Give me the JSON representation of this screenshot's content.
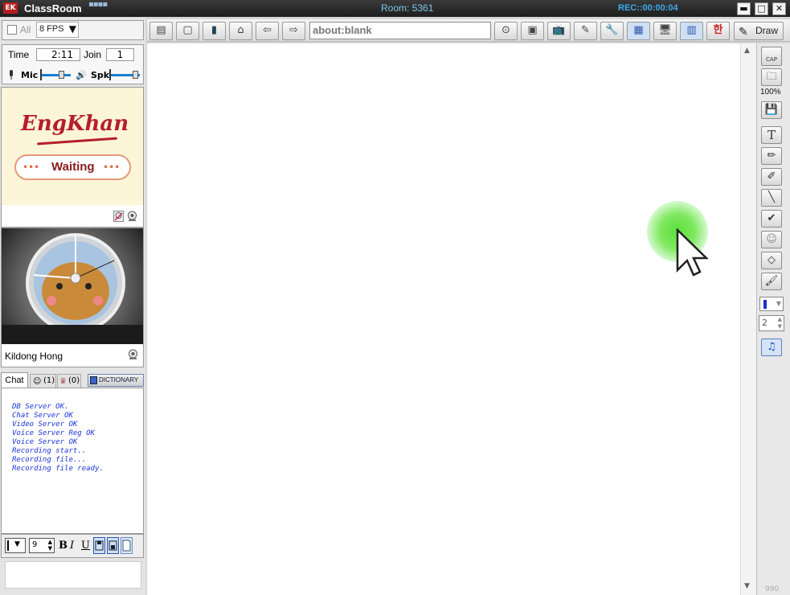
{
  "titlebar": {
    "app_logo": "EK",
    "app_title": "ClassRoom",
    "room": "Room: 5361",
    "rec": "REC::00:00:04",
    "minimize": "▬",
    "maximize": "□",
    "close": "✕"
  },
  "left_panel": {
    "all_label": "All",
    "fps_value": "8 FPS",
    "time_label": "Time",
    "time_value": "2:11",
    "join_label": "Join",
    "join_value": "1",
    "mic_label": "Mic",
    "spk_label": "Spk",
    "brand_logo": "EngKhan",
    "waiting_dots_left": "•••",
    "waiting_text": "Waiting",
    "waiting_dots_right": "•••",
    "student_name": "Kildong Hong"
  },
  "chat": {
    "tabs": [
      {
        "label": "Chat"
      },
      {
        "label": "(1)"
      },
      {
        "label": "(0)"
      }
    ],
    "dictionary_label": "DICTIONARY",
    "log": [
      "DB Server OK.",
      "Chat Server OK",
      "Video Server OK",
      "Voice Server Reg OK",
      "Voice Server OK",
      "Recording start..",
      "Recording file...",
      "Recording file ready."
    ],
    "font_size": "9",
    "bold_label": "B",
    "italic_label": "I",
    "underline_label": "U",
    "input_value": ""
  },
  "toolbar": {
    "url": "about:blank",
    "korean_label": "한",
    "draw_label": "Draw"
  },
  "right_tools": {
    "cap_label": "CAP",
    "zoom_label": "100%",
    "line_width": "2"
  },
  "status": {
    "corner_text": "990"
  },
  "colors": {
    "title_bg": "#2b2b2b",
    "room_text": "#7fc6e8",
    "rec_text": "#3fa9e8",
    "chat_text": "#1a35d8",
    "waiting_text": "#8a1c1c",
    "brand_red": "#b51e2a",
    "cursor_glow": "#5ae03a"
  },
  "icons": [
    "mic-icon",
    "speaker-icon",
    "webcam-icon",
    "print-icon",
    "home-icon",
    "back-arrow-icon",
    "forward-arrow-icon",
    "go-icon",
    "text-tool-icon",
    "pen-icon",
    "highlighter-icon",
    "line-icon",
    "check-icon",
    "eraser-icon",
    "brush-icon",
    "color-picker-icon",
    "music-note-icon",
    "save-icon",
    "folder-icon",
    "wrench-icon",
    "tv-icon"
  ]
}
